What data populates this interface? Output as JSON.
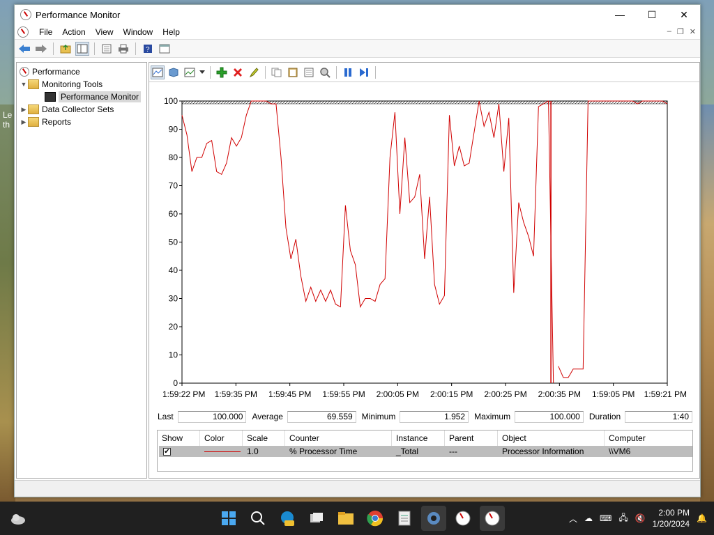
{
  "window": {
    "title": "Performance Monitor",
    "controls": {
      "minimize": "—",
      "maximize": "☐",
      "close": "✕"
    }
  },
  "menu": [
    "File",
    "Action",
    "View",
    "Window",
    "Help"
  ],
  "mdi_controls": {
    "minimize": "–",
    "restore": "❐",
    "close": "✕"
  },
  "tree": {
    "root": "Performance",
    "monitoring_tools": "Monitoring Tools",
    "performance_monitor": "Performance Monitor",
    "data_collector_sets": "Data Collector Sets",
    "reports": "Reports"
  },
  "desktop_text": {
    "left_line1": "Le",
    "left_line2": "th"
  },
  "stats": {
    "last_label": "Last",
    "last": "100.000",
    "average_label": "Average",
    "average": "69.559",
    "minimum_label": "Minimum",
    "minimum": "1.952",
    "maximum_label": "Maximum",
    "maximum": "100.000",
    "duration_label": "Duration",
    "duration": "1:40"
  },
  "legend": {
    "headers": {
      "show": "Show",
      "color": "Color",
      "scale": "Scale",
      "counter": "Counter",
      "instance": "Instance",
      "parent": "Parent",
      "object": "Object",
      "computer": "Computer"
    },
    "row": {
      "show": "✔",
      "scale": "1.0",
      "counter": "% Processor Time",
      "instance": "_Total",
      "parent": "---",
      "object": "Processor Information",
      "computer": "\\\\VM6",
      "color": "#d00000"
    }
  },
  "clock": {
    "time": "2:00 PM",
    "date": "1/20/2024"
  },
  "colors": {
    "series": "#d00000",
    "taskbar": "#202020"
  },
  "chart_data": {
    "type": "line",
    "ylim": [
      0,
      100
    ],
    "yticks": [
      0,
      10,
      20,
      30,
      40,
      50,
      60,
      70,
      80,
      90,
      100
    ],
    "xtick_labels": [
      "1:59:22 PM",
      "1:59:35 PM",
      "1:59:45 PM",
      "1:59:55 PM",
      "2:00:05 PM",
      "2:00:15 PM",
      "2:00:25 PM",
      "2:00:35 PM",
      "1:59:05 PM",
      "1:59:21 PM"
    ],
    "grid": false,
    "series": [
      {
        "name": "% Processor Time",
        "values": [
          95,
          88,
          75,
          80,
          80,
          85,
          86,
          75,
          74,
          78,
          87,
          84,
          87,
          95,
          100,
          100,
          100,
          100,
          99,
          99,
          80,
          55,
          44,
          51,
          38,
          29,
          34,
          29,
          33,
          29,
          33,
          28,
          27,
          63,
          47,
          42,
          27,
          30,
          30,
          29,
          35,
          37,
          80,
          96,
          60,
          87,
          64,
          66,
          74,
          44,
          66,
          35,
          28,
          31,
          95,
          77,
          84,
          77,
          78,
          89,
          100,
          91,
          96,
          87,
          99,
          75,
          94,
          32,
          64,
          57,
          52,
          45,
          98,
          99,
          100,
          null,
          6,
          2,
          2,
          5,
          5,
          5,
          100,
          100,
          100,
          100,
          100,
          100,
          100,
          100,
          100,
          100,
          99,
          100,
          100,
          100,
          100,
          100,
          99
        ],
        "break_after": 74
      }
    ]
  }
}
